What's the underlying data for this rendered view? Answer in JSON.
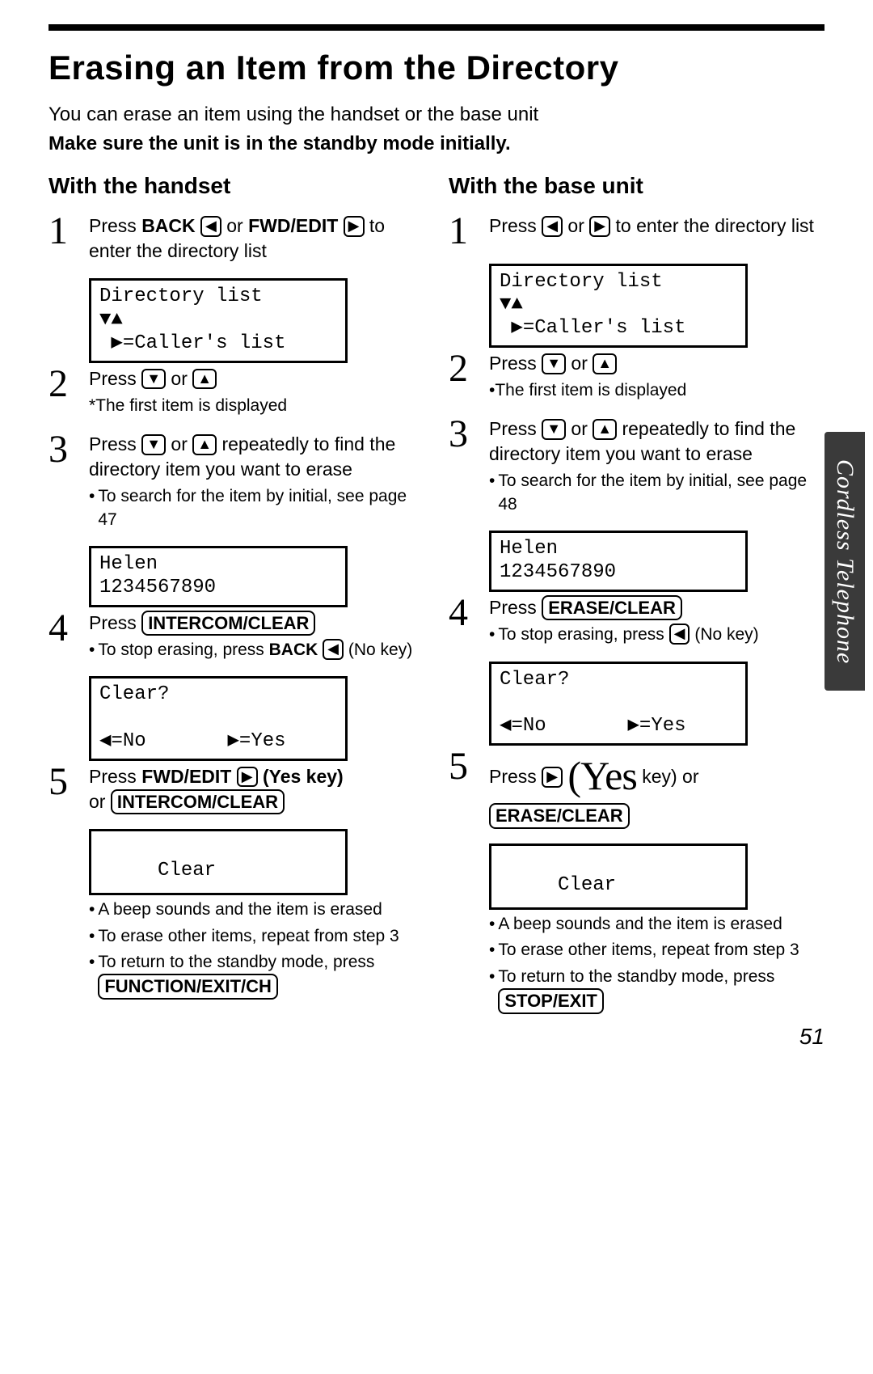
{
  "page_number": "51",
  "side_tab": "Cordless Telephone",
  "title": "Erasing an Item from the Directory",
  "intro_line": "You can erase an item using the handset or the base unit",
  "intro_bold": "Make sure the unit is in the standby mode initially.",
  "icons": {
    "left": "◀",
    "right": "▶",
    "down": "▼",
    "up": "▲"
  },
  "handset": {
    "heading": "With the handset",
    "step1": {
      "num": "1",
      "line_a": "Press ",
      "back_label": "BACK",
      "or1": " or ",
      "fwd_label": "FWD/EDIT",
      "line_b": " to enter the directory list",
      "screen_l1": "Directory list",
      "screen_l2": "▼▲",
      "screen_l3": " ▶=Caller's list"
    },
    "step2": {
      "num": "2",
      "line_a": "Press ",
      "or1": " or ",
      "note": "*The first item is displayed"
    },
    "step3": {
      "num": "3",
      "line_a": "Press ",
      "or1": " or ",
      "line_b": " repeatedly to find the directory item you want to erase",
      "bullet": "To search for the item by initial, see page 47",
      "screen_l1": "Helen",
      "screen_l2": "1234567890"
    },
    "step4": {
      "num": "4",
      "line_a": "Press ",
      "btn": "INTERCOM/CLEAR",
      "bullet_a": "To stop erasing, press ",
      "bullet_back": "BACK",
      "bullet_b": " (No key)",
      "screen_l1": "Clear?",
      "screen_l2": "",
      "screen_l3": "◀=No       ▶=Yes"
    },
    "step5": {
      "num": "5",
      "line_a": "Press ",
      "fwd": "FWD/EDIT",
      "yes": " (Yes key)",
      "or": "or ",
      "btn": "INTERCOM/CLEAR",
      "screen_l1": "",
      "screen_l2": "     Clear",
      "bullet1": "A beep sounds and the item is erased",
      "bullet2": "To erase other items, repeat from step 3",
      "bullet3_a": "To return to the standby mode, press ",
      "bullet3_btn": "FUNCTION/EXIT/CH"
    }
  },
  "base": {
    "heading": "With the base unit",
    "step1": {
      "num": "1",
      "line_a": "Press ",
      "or1": " or ",
      "line_b": " to enter the directory list",
      "screen_l1": "Directory list",
      "screen_l2": "▼▲",
      "screen_l3": " ▶=Caller's list"
    },
    "step2": {
      "num": "2",
      "line_a": "Press ",
      "or1": " or ",
      "note": "•The first item is displayed"
    },
    "step3": {
      "num": "3",
      "line_a": "Press ",
      "or1": " or ",
      "line_b": " repeatedly to find the directory item you want to erase",
      "bullet": "To search for the item by initial, see page 48",
      "screen_l1": "Helen",
      "screen_l2": "1234567890"
    },
    "step4": {
      "num": "4",
      "line_a": "Press ",
      "btn": "ERASE/CLEAR",
      "bullet_a": "To stop erasing, press ",
      "bullet_b": " (No key)",
      "screen_l1": "Clear?",
      "screen_l2": "",
      "screen_l3": "◀=No       ▶=Yes"
    },
    "step5": {
      "num": "5",
      "line_a": "Press",
      "yes_big": "(Yes",
      "yes_tail": " key) or",
      "btn": "ERASE/CLEAR",
      "screen_l1": "",
      "screen_l2": "     Clear",
      "bullet1": "A beep sounds and the item is erased",
      "bullet2": "To erase other items, repeat from step 3",
      "bullet3_a": "To return to the standby mode, press ",
      "bullet3_btn": "STOP/EXIT"
    }
  }
}
